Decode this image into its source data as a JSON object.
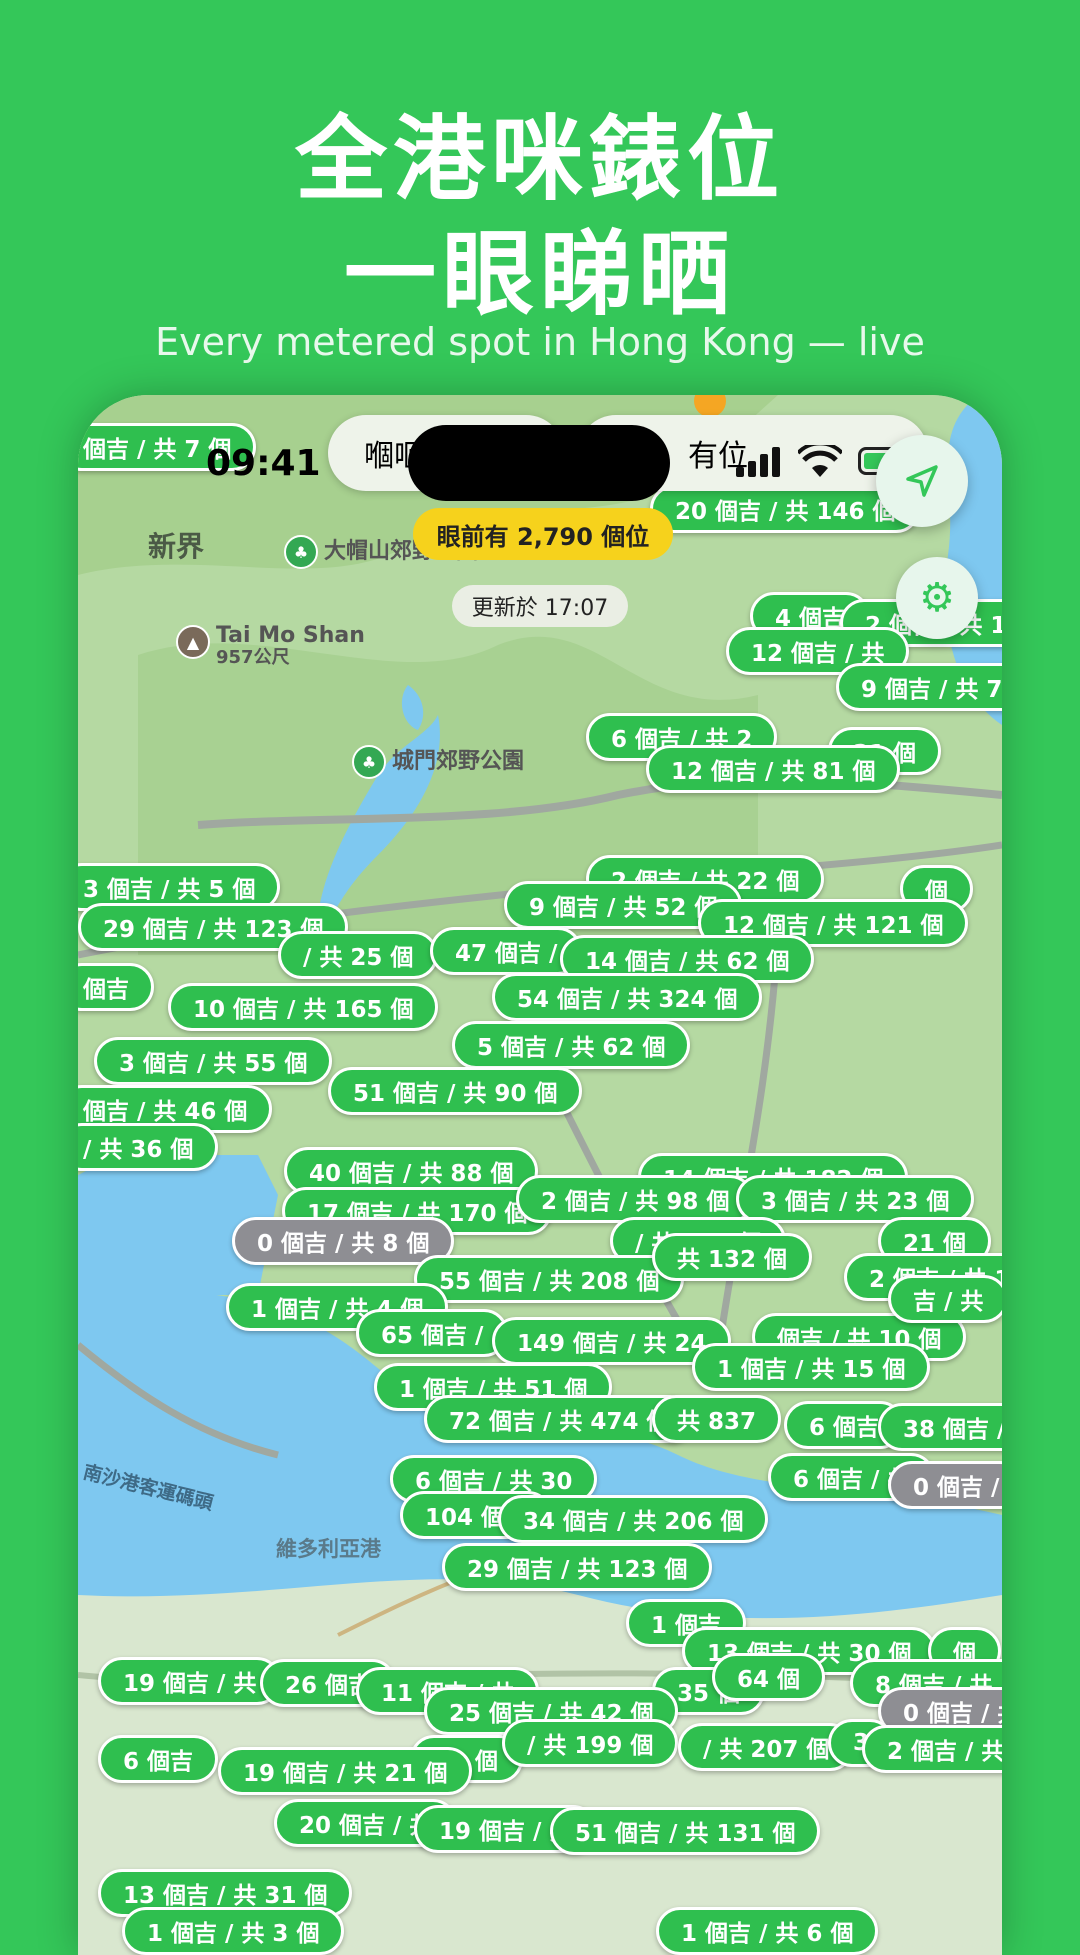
{
  "promo": {
    "headline_line1": "全港咪錶位",
    "headline_line2": "一眼睇晒",
    "subtitle": "Every metered spot in Hong Kong — live"
  },
  "status_bar": {
    "time": "09:41"
  },
  "filters": {
    "left_label": "嗰咂",
    "right_label": "有位"
  },
  "availability": {
    "summary": "眼前有 2,790 個位",
    "updated": "更新於 17:07"
  },
  "places": {
    "new_territories": "新界",
    "tai_mo_shan": "Tai Mo Shan",
    "tai_mo_shan_elev": "957公尺",
    "tai_mo_shan_park": "大帽山郊野公園",
    "shing_mun_park": "城門郊野公園",
    "victoria_harbour": "維多利亞港",
    "cruise_terminal": "南沙港客運碼頭"
  },
  "colors": {
    "accent": "#34c759",
    "pin_available": "#2fbf4f",
    "pin_empty": "#8e8e93",
    "summary_pill": "#f6d21c"
  },
  "icons": {
    "locate": "location-arrow-icon",
    "settings": "gear-icon",
    "park": "tree-icon",
    "mountain": "mountain-icon"
  },
  "pins": [
    {
      "label": "個吉 / 共 7 個",
      "empty": false
    },
    {
      "label": "20 個吉 / 共 146 個",
      "empty": false
    },
    {
      "label": "4 個吉",
      "empty": false
    },
    {
      "label": "2 個吉 / 共 1",
      "empty": false
    },
    {
      "label": "12 個吉 / 共",
      "empty": false
    },
    {
      "label": "9 個吉 / 共 74",
      "empty": false
    },
    {
      "label": "6 個吉 / 共 2",
      "empty": false
    },
    {
      "label": "21 個",
      "empty": false
    },
    {
      "label": "12 個吉 / 共 81 個",
      "empty": false
    },
    {
      "label": "2 個吉 / 共 22 個",
      "empty": false
    },
    {
      "label": "3 個吉 / 共 5 個",
      "empty": false
    },
    {
      "label": "9 個吉 / 共 52 個",
      "empty": false
    },
    {
      "label": "個",
      "empty": false
    },
    {
      "label": "12 個吉 / 共 121 個",
      "empty": false
    },
    {
      "label": "29 個吉 / 共 123 個",
      "empty": false
    },
    {
      "label": "/ 共 25 個",
      "empty": false
    },
    {
      "label": "47 個吉 /",
      "empty": false
    },
    {
      "label": "14 個吉 / 共 62 個",
      "empty": false
    },
    {
      "label": "個吉",
      "empty": false
    },
    {
      "label": "10 個吉 / 共 165 個",
      "empty": false
    },
    {
      "label": "54 個吉 / 共 324 個",
      "empty": false
    },
    {
      "label": "5 個吉 / 共 62 個",
      "empty": false
    },
    {
      "label": "3 個吉 / 共 55 個",
      "empty": false
    },
    {
      "label": "51 個吉 / 共 90 個",
      "empty": false
    },
    {
      "label": "個吉 / 共 46 個",
      "empty": false
    },
    {
      "label": "/ 共 36 個",
      "empty": false
    },
    {
      "label": "14 個吉 / 共 182 個",
      "empty": false
    },
    {
      "label": "40 個吉 / 共 88 個",
      "empty": false
    },
    {
      "label": "17 個吉 / 共 170 個",
      "empty": false
    },
    {
      "label": "2 個吉 / 共 98 個",
      "empty": false
    },
    {
      "label": "3 個吉 / 共 23 個",
      "empty": false
    },
    {
      "label": "0 個吉 / 共 8 個",
      "empty": true
    },
    {
      "label": "/ 共 148 個",
      "empty": false
    },
    {
      "label": "21 個",
      "empty": false
    },
    {
      "label": "55 個吉 / 共 208 個",
      "empty": false
    },
    {
      "label": "共 132 個",
      "empty": false
    },
    {
      "label": "2 個吉 / 共 1",
      "empty": false
    },
    {
      "label": "1 個吉 / 共 4 個",
      "empty": false
    },
    {
      "label": "65 個吉 /",
      "empty": false
    },
    {
      "label": "149 個吉 / 共 24",
      "empty": false
    },
    {
      "label": "個吉 / 共 10 個",
      "empty": false
    },
    {
      "label": "吉 / 共",
      "empty": false
    },
    {
      "label": "1 個吉 / 共 15 個",
      "empty": false
    },
    {
      "label": "1 個吉 / 共 51 個",
      "empty": false
    },
    {
      "label": "72 個吉 / 共 474 個",
      "empty": false
    },
    {
      "label": "共 837",
      "empty": false
    },
    {
      "label": "6 個吉",
      "empty": false
    },
    {
      "label": "38 個吉 / 共",
      "empty": false
    },
    {
      "label": "6 個吉 / 共 30",
      "empty": false
    },
    {
      "label": "6 個吉 / 共",
      "empty": false
    },
    {
      "label": "0 個吉 /",
      "empty": true
    },
    {
      "label": "104 個吉",
      "empty": false
    },
    {
      "label": "34 個吉 / 共 206 個",
      "empty": false
    },
    {
      "label": "29 個吉 / 共 123 個",
      "empty": false
    },
    {
      "label": "1 個吉",
      "empty": false
    },
    {
      "label": "13 個吉 / 共 30 個",
      "empty": false
    },
    {
      "label": "個",
      "empty": false
    },
    {
      "label": "19 個吉 / 共",
      "empty": false
    },
    {
      "label": "26 個吉",
      "empty": false
    },
    {
      "label": "11 個吉 / 共",
      "empty": false
    },
    {
      "label": "35 個",
      "empty": false
    },
    {
      "label": "64 個",
      "empty": false
    },
    {
      "label": "8 個吉 / 共 8",
      "empty": false
    },
    {
      "label": "25 個吉 / 共 42 個",
      "empty": false
    },
    {
      "label": "0 個吉 / 共",
      "empty": true
    },
    {
      "label": "6 個吉",
      "empty": false
    },
    {
      "label": "29 個",
      "empty": false
    },
    {
      "label": "/ 共 199 個",
      "empty": false
    },
    {
      "label": "/ 共 207 個",
      "empty": false
    },
    {
      "label": "3",
      "empty": false
    },
    {
      "label": "2 個吉 / 共",
      "empty": false
    },
    {
      "label": "19 個吉 / 共 21 個",
      "empty": false
    },
    {
      "label": "20 個吉 / 共",
      "empty": false
    },
    {
      "label": "19 個吉 / 共",
      "empty": false
    },
    {
      "label": "51 個吉 / 共 131 個",
      "empty": false
    },
    {
      "label": "13 個吉 / 共 31 個",
      "empty": false
    },
    {
      "label": "1 個吉 / 共 3 個",
      "empty": false
    },
    {
      "label": "1 個吉 / 共 6 個",
      "empty": false
    }
  ]
}
